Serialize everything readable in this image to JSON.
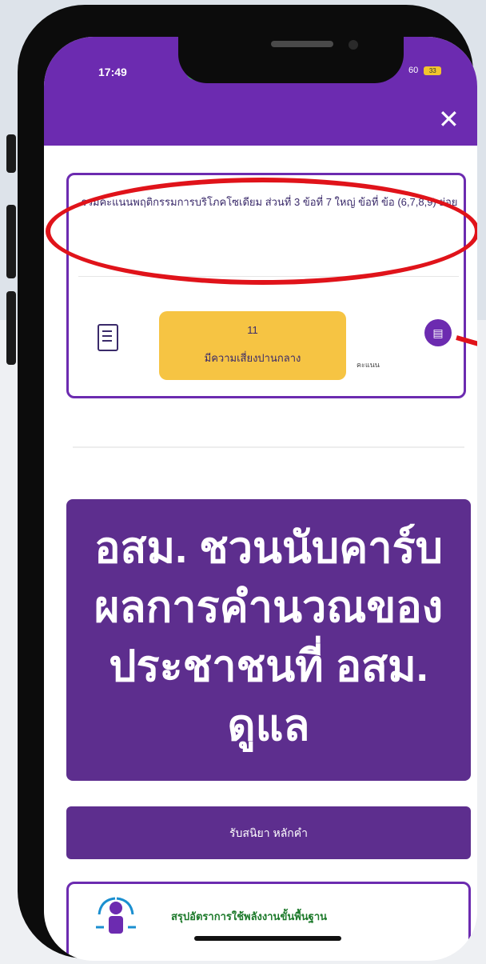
{
  "status_bar": {
    "time": "17:49",
    "right": "60",
    "battery": "33"
  },
  "header": {
    "close_symbol": "✕",
    "accent_color": "#6c2bb0"
  },
  "card_top": {
    "title": "รวมคะแนนพฤติกรรมการบริโภคโซเดียม ส่วนที่ 3 ข้อที่ 7 ใหญ่ ข้อที่ ข้อ (6,7,8,9) ย่อย",
    "badge_line1": "11",
    "badge_line2": "มีความเสี่ยงปานกลาง",
    "small_text": "คะแนน",
    "doc_icon": "document-icon",
    "pdf_icon": "pdf-file-icon",
    "badge_color": "#f6c443",
    "annotation_color": "#e0131a"
  },
  "banner": {
    "text": "อสม. ชวนนับคาร์บ ผลการคำนวณของ ประชาชนที่ อสม. ดูแล",
    "color": "#5d2e8e"
  },
  "action_button": {
    "label": "รับสนิยา หลักคำ"
  },
  "card_bottom": {
    "title": "สรุปอัตราการใช้พลังงานขั้นพื้นฐาน",
    "icon": "person-arrows-icon"
  }
}
